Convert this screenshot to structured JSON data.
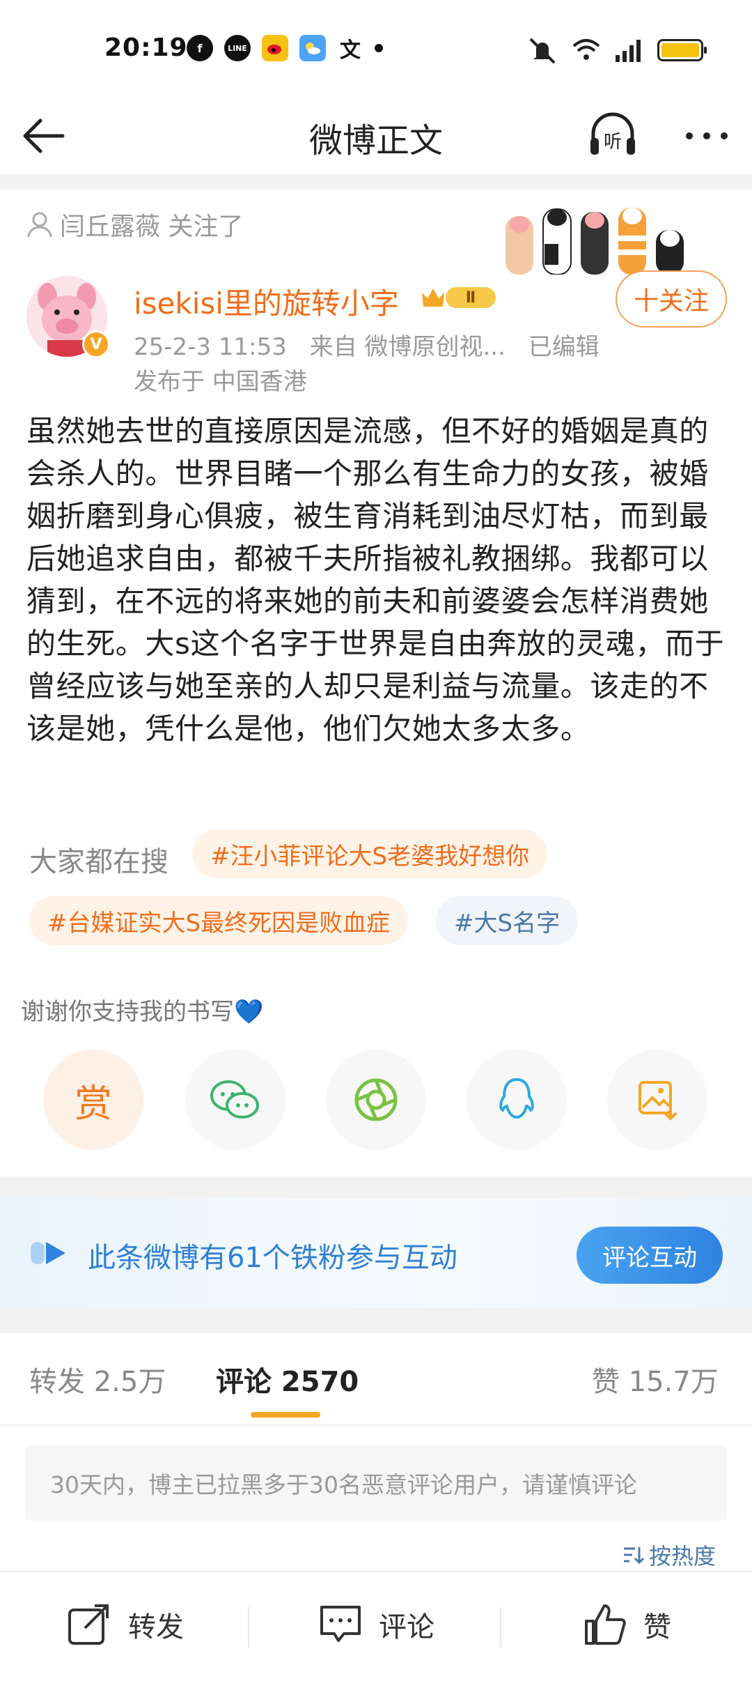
{
  "status_bar": {
    "time": "20:19",
    "app_icons": [
      "facebook-icon",
      "line-icon",
      "weibo-icon",
      "weather-icon",
      "translate-icon",
      "dot-icon"
    ],
    "right_icons": [
      "mute-icon",
      "wifi-icon",
      "signal-icon",
      "battery-icon"
    ],
    "battery_level": 1.0
  },
  "nav": {
    "title": "微博正文",
    "listen_label": "听"
  },
  "post": {
    "followed_by": "闫丘露薇 关注了",
    "author": "isekisi里的旋转小字",
    "verified_badge": "V",
    "level_badge": "Ⅱ",
    "time": "25-2-3 11:53",
    "source": "来自 微博原创视...",
    "edited": "已编辑",
    "location": "发布于 中国香港",
    "follow_label": "十关注",
    "body": "虽然她去世的直接原因是流感，但不好的婚姻是真的会杀人的。世界目睹一个那么有生命力的女孩，被婚姻折磨到身心俱疲，被生育消耗到油尽灯枯，而到最后她追求自由，都被千夫所指被礼教捆绑。我都可以猜到，在不远的将来她的前夫和前婆婆会怎样消费她的生死。大s这个名字于世界是自由奔放的灵魂，而于曾经应该与她至亲的人却只是利益与流量。该走的不该是她，凭什么是他，他们欠她太多太多。"
  },
  "search": {
    "label": "大家都在搜",
    "tags": [
      {
        "text": "#汪小菲评论大S老婆我好想你",
        "style": "hot"
      },
      {
        "text": "#台媒证实大S最终死因是败血症",
        "style": "hot"
      },
      {
        "text": "#大S名字",
        "style": "blue"
      }
    ]
  },
  "reward": {
    "label": "谢谢你支持我的书写💙",
    "reward_char": "赏",
    "share_targets": [
      "reward-button",
      "wechat-icon",
      "moments-icon",
      "qq-icon",
      "save-image-icon"
    ]
  },
  "fans_banner": {
    "text": "此条微博有61个铁粉参与互动",
    "button": "评论互动"
  },
  "tabs": [
    {
      "label": "转发 2.5万"
    },
    {
      "label": "评论 2570"
    },
    {
      "label": "赞 15.7万"
    }
  ],
  "notice": "30天内，博主已拉黑多于30名恶意评论用户，请谨慎评论",
  "sort_label": "按热度",
  "bottom_bar": [
    {
      "label": "转发",
      "icon": "repost-icon"
    },
    {
      "label": "评论",
      "icon": "comment-icon"
    },
    {
      "label": "赞",
      "icon": "like-icon"
    }
  ],
  "colors": {
    "accent_orange": "#f06d1b",
    "tab_underline": "#f5a623",
    "blue": "#2f7fd5"
  }
}
